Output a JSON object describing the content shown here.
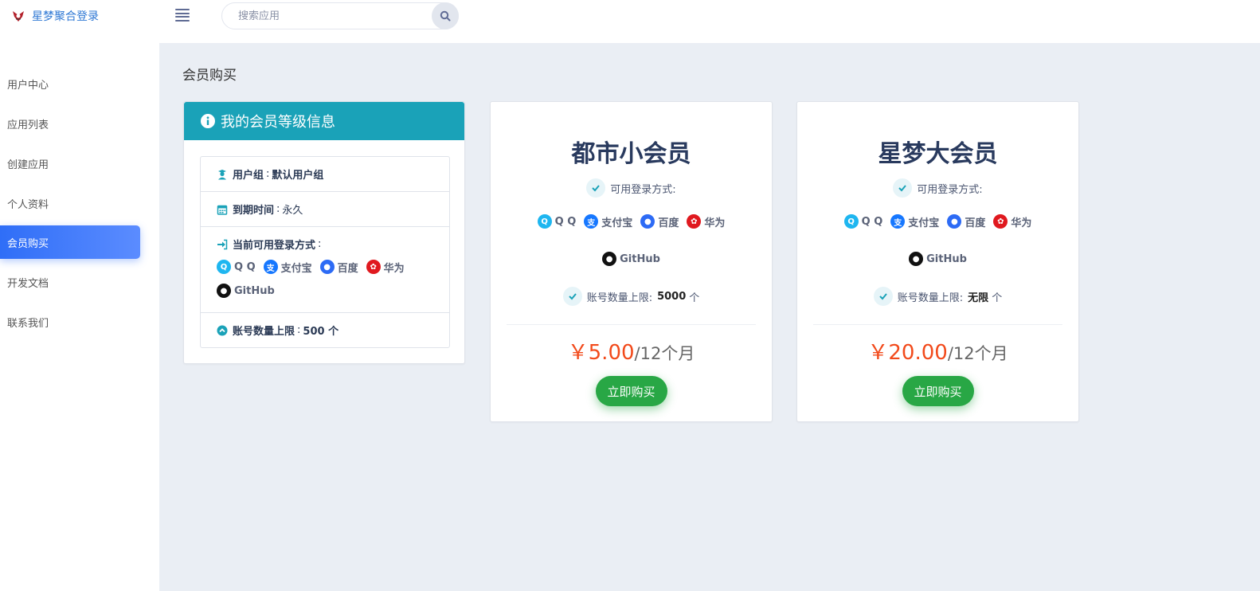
{
  "header": {
    "brand": "星梦聚合登录",
    "search_placeholder": "搜索应用"
  },
  "sidebar": {
    "items": [
      {
        "label": "用户中心"
      },
      {
        "label": "应用列表"
      },
      {
        "label": "创建应用"
      },
      {
        "label": "个人资料"
      },
      {
        "label": "会员购买",
        "active": true
      },
      {
        "label": "开发文档"
      },
      {
        "label": "联系我们"
      }
    ]
  },
  "page_title": "会员购买",
  "info_card": {
    "title": "我的会员等级信息",
    "group_label": "用户组",
    "group_value": "默认用户组",
    "expire_label": "到期时间",
    "expire_value": "永久",
    "methods_label": "当前可用登录方式",
    "limit_label": "账号数量上限",
    "limit_value": "500 个"
  },
  "login_methods": [
    {
      "name": "Q Q",
      "icon": "qq-icon",
      "color": "#1eb6f0"
    },
    {
      "name": "支付宝",
      "icon": "alipay-icon",
      "color": "#1677ff"
    },
    {
      "name": "百度",
      "icon": "baidu-icon",
      "color": "#2d6bf5"
    },
    {
      "name": "华为",
      "icon": "huawei-icon",
      "color": "#e0191f"
    },
    {
      "name": "GitHub",
      "icon": "github-icon",
      "color": "#111111"
    }
  ],
  "plans": [
    {
      "name": "都市小会员",
      "methods_label": "可用登录方式:",
      "limit_label": "账号数量上限:",
      "limit_value": "5000",
      "limit_unit": "个",
      "price": "￥5.00",
      "period": "/12个月",
      "buy_label": "立即购买"
    },
    {
      "name": "星梦大会员",
      "methods_label": "可用登录方式:",
      "limit_label": "账号数量上限:",
      "limit_value": "无限",
      "limit_unit": "个",
      "price": "￥20.00",
      "period": "/12个月",
      "buy_label": "立即购买"
    }
  ],
  "colors": {
    "accent": "#2f6ef7",
    "info_header": "#1aa2b8",
    "price": "#f24a1b",
    "buy_button": "#28a745"
  }
}
